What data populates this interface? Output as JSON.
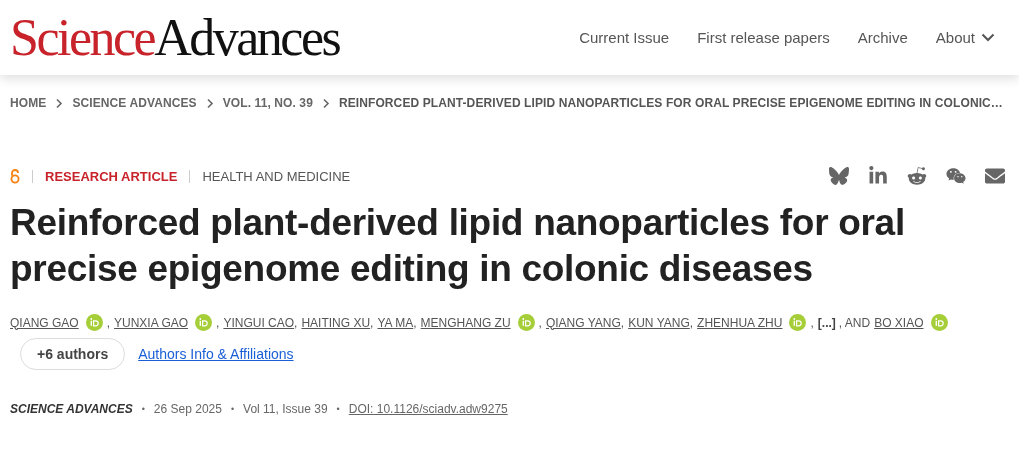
{
  "header": {
    "logo": {
      "first": "Science",
      "second": "Advances"
    },
    "nav": [
      {
        "label": "Current Issue",
        "dropdown": false
      },
      {
        "label": "First release papers",
        "dropdown": false
      },
      {
        "label": "Archive",
        "dropdown": false
      },
      {
        "label": "About",
        "dropdown": true
      }
    ]
  },
  "breadcrumb": [
    "HOME",
    "SCIENCE ADVANCES",
    "VOL. 11, NO. 39",
    "REINFORCED PLANT-DERIVED LIPID NANOPARTICLES FOR ORAL PRECISE EPIGENOME EDITING IN COLONIC…"
  ],
  "article": {
    "open_access": true,
    "type": "RESEARCH ARTICLE",
    "subject": "HEALTH AND MEDICINE",
    "share": [
      {
        "kind": "bluesky"
      },
      {
        "kind": "linkedin"
      },
      {
        "kind": "reddit"
      },
      {
        "kind": "wechat"
      },
      {
        "kind": "email"
      }
    ],
    "title": "Reinforced plant-derived lipid nanoparticles for oral precise epigenome editing in colonic diseases",
    "authors": [
      {
        "kind": "author",
        "text": "QIANG GAO",
        "orcid": true
      },
      {
        "kind": "sep",
        "text": ","
      },
      {
        "kind": "author",
        "text": "YUNXIA GAO",
        "orcid": true
      },
      {
        "kind": "sep",
        "text": ","
      },
      {
        "kind": "author",
        "text": "YINGUI CAO",
        "orcid": false
      },
      {
        "kind": "sep",
        "text": ","
      },
      {
        "kind": "author",
        "text": "HAITING XU",
        "orcid": false
      },
      {
        "kind": "sep",
        "text": ","
      },
      {
        "kind": "author",
        "text": "YA MA",
        "orcid": false
      },
      {
        "kind": "sep",
        "text": ","
      },
      {
        "kind": "author",
        "text": "MENGHANG ZU",
        "orcid": true
      },
      {
        "kind": "sep",
        "text": ","
      },
      {
        "kind": "author",
        "text": "QIANG YANG",
        "orcid": false
      },
      {
        "kind": "sep",
        "text": ","
      },
      {
        "kind": "author",
        "text": "KUN YANG",
        "orcid": false
      },
      {
        "kind": "sep",
        "text": ","
      },
      {
        "kind": "author",
        "text": "ZHENHUA ZHU",
        "orcid": true
      },
      {
        "kind": "sep",
        "text": ","
      },
      {
        "kind": "more",
        "text": "[...]"
      },
      {
        "kind": "sep",
        "text": ", AND"
      },
      {
        "kind": "author",
        "text": "BO XIAO",
        "orcid": true
      }
    ],
    "more_authors": "+6 authors",
    "affiliations_link": "Authors Info & Affiliations",
    "meta": {
      "journal": "SCIENCE ADVANCES",
      "date": "26 Sep 2025",
      "issue": "Vol 11, Issue 39",
      "doi": "DOI: 10.1126/sciadv.adw9275",
      "separator": "•"
    }
  }
}
